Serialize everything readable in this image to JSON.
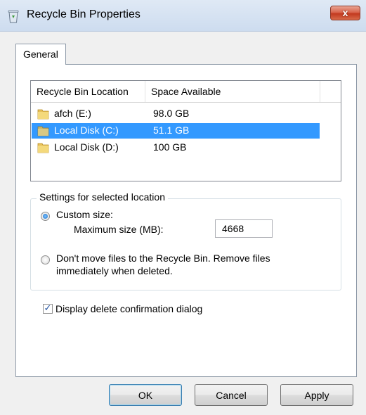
{
  "window": {
    "title": "Recycle Bin Properties",
    "close_label": "x"
  },
  "tabs": [
    {
      "label": "General",
      "active": true
    }
  ],
  "list": {
    "columns": [
      "Recycle Bin Location",
      "Space Available"
    ],
    "rows": [
      {
        "name": "afch (E:)",
        "space": "98.0 GB",
        "selected": false,
        "icon": "folder-icon"
      },
      {
        "name": "Local Disk (C:)",
        "space": "51.1 GB",
        "selected": true,
        "icon": "folder-icon"
      },
      {
        "name": "Local Disk (D:)",
        "space": "100 GB",
        "selected": false,
        "icon": "folder-icon"
      }
    ]
  },
  "settings": {
    "group_title": "Settings for selected location",
    "custom_size_label": "Custom size:",
    "custom_size_checked": true,
    "max_size_label": "Maximum size (MB):",
    "max_size_value": "4668",
    "dont_move_line1": "Don't move files to the Recycle Bin. Remove files",
    "dont_move_line2": "immediately when deleted.",
    "dont_move_checked": false
  },
  "confirm": {
    "label": "Display delete confirmation dialog",
    "checked": true
  },
  "buttons": {
    "ok": "OK",
    "cancel": "Cancel",
    "apply": "Apply"
  },
  "colors": {
    "selection": "#3399ff",
    "close_button": "#c2391f"
  }
}
